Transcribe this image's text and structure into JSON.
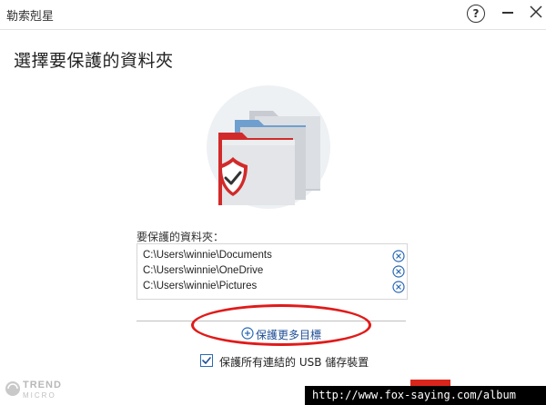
{
  "window": {
    "title": "勒索剋星",
    "help_label": "?"
  },
  "page": {
    "heading": "選擇要保護的資料夾"
  },
  "protected": {
    "label": "要保護的資料夾：",
    "folders": [
      "C:\\Users\\winnie\\Documents",
      "C:\\Users\\winnie\\OneDrive",
      "C:\\Users\\winnie\\Pictures"
    ]
  },
  "actions": {
    "add_more_label": "保護更多目標",
    "usb_checkbox_label": "保護所有連結的 USB 儲存裝置",
    "usb_checked": true
  },
  "brand": {
    "line1": "TREND",
    "line2": "MICRO"
  },
  "watermark": "http://www.fox-saying.com/album",
  "colors": {
    "accent_blue": "#2a6ab5",
    "brand_red": "#d9261c",
    "highlight_red": "#e11a1a"
  },
  "icons": {
    "help": "help-icon",
    "minimize": "minimize-icon",
    "close": "close-icon",
    "remove": "remove-circle-icon",
    "add": "add-circle-icon",
    "hero": "protected-folders-icon",
    "shield": "shield-check-icon",
    "checkbox": "checkmark-icon"
  }
}
